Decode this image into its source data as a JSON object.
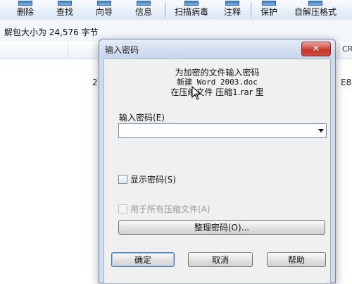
{
  "toolbar": {
    "buttons": [
      {
        "label": "删除",
        "icon": "delete-icon"
      },
      {
        "label": "查找",
        "icon": "find-icon"
      },
      {
        "label": "向导",
        "icon": "wizard-icon"
      },
      {
        "label": "信息",
        "icon": "info-icon"
      },
      {
        "label": "扫描病毒",
        "icon": "virus-scan-icon"
      },
      {
        "label": "注释",
        "icon": "comment-icon"
      },
      {
        "label": "保护",
        "icon": "protect-icon"
      },
      {
        "label": "自解压格式",
        "icon": "sfx-icon"
      }
    ]
  },
  "status": {
    "text": "解包大小为 24,576 字节"
  },
  "filelist": {
    "col_partial": "CR",
    "row_left": "2",
    "row_right": "E8"
  },
  "dialog": {
    "title": "输入密码",
    "close_label": "✕",
    "message": {
      "line1": "为加密的文件输入密码",
      "line2": "新建 Word 2003.doc",
      "line3": "在压缩文件 压缩1.rar 里"
    },
    "password_label": "输入密码(E)",
    "password_value": "",
    "show_password_label": "显示密码(S)",
    "all_archives_label": "用于所有压缩文件(A)",
    "organize_button": "整理密码(O)...",
    "ok_button": "确定",
    "cancel_button": "取消",
    "help_button": "帮助"
  },
  "colors": {
    "dialog_frame": "#cfdced",
    "close_button": "#c7352a",
    "toolbar_bg": "#dce7f5"
  }
}
